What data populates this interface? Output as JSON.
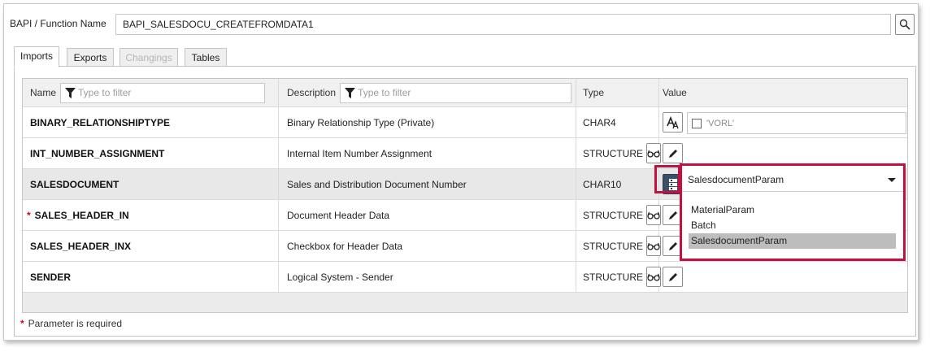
{
  "bapi": {
    "label": "BAPI / Function Name",
    "value": "BAPI_SALESDOCU_CREATEFROMDATA1"
  },
  "tabs": [
    {
      "label": "Imports",
      "state": "active"
    },
    {
      "label": "Exports",
      "state": "normal"
    },
    {
      "label": "Changings",
      "state": "disabled"
    },
    {
      "label": "Tables",
      "state": "normal"
    }
  ],
  "columns": {
    "name": "Name",
    "name_filter_placeholder": "Type to filter",
    "description": "Description",
    "description_filter_placeholder": "Type to filter",
    "type": "Type",
    "value": "Value"
  },
  "rows": [
    {
      "name": "BINARY_RELATIONSHIPTYPE",
      "required": false,
      "description": "Binary Relationship Type (Private)",
      "type": "CHAR4",
      "value_text": "'VORL'",
      "checked": false
    },
    {
      "name": "INT_NUMBER_ASSIGNMENT",
      "required": false,
      "description": "Internal Item Number Assignment",
      "type": "STRUCTURE"
    },
    {
      "name": "SALESDOCUMENT",
      "required": false,
      "description": "Sales and Distribution Document Number",
      "type": "CHAR10",
      "value_text": "SalesdocumentParam"
    },
    {
      "name": "SALES_HEADER_IN",
      "required": true,
      "description": "Document Header Data",
      "type": "STRUCTURE"
    },
    {
      "name": "SALES_HEADER_INX",
      "required": false,
      "description": "Checkbox for Header Data",
      "type": "STRUCTURE"
    },
    {
      "name": "SENDER",
      "required": false,
      "description": "Logical System - Sender",
      "type": "STRUCTURE"
    }
  ],
  "dropdown": {
    "selected": "SalesdocumentParam",
    "options": [
      "MaterialParam",
      "Batch",
      "SalesdocumentParam"
    ]
  },
  "footnote": {
    "marker": "*",
    "text": "Parameter is required"
  },
  "colors": {
    "required": "#d6001c",
    "highlight": "#c4103e",
    "bind_button": "#3a5068"
  }
}
